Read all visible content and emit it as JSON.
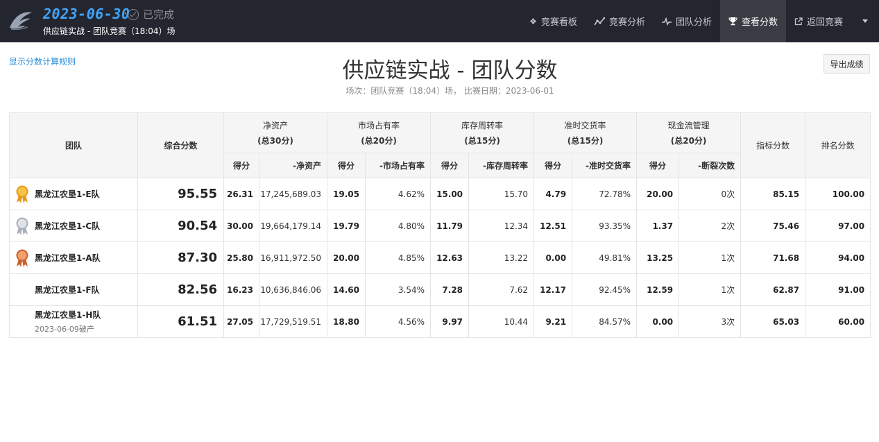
{
  "header": {
    "date": "2023-06-30",
    "status": "已完成",
    "subtitle": "供应链实战 - 团队竞赛（18:04）场"
  },
  "nav": [
    {
      "label": "竞赛看板",
      "icon": "dashboard-icon",
      "active": false
    },
    {
      "label": "竞赛分析",
      "icon": "line-chart-icon",
      "active": false
    },
    {
      "label": "团队分析",
      "icon": "pulse-icon",
      "active": false
    },
    {
      "label": "查看分数",
      "icon": "trophy-icon",
      "active": true
    },
    {
      "label": "返回竞赛",
      "icon": "external-link-icon",
      "active": false
    }
  ],
  "page": {
    "rule_link": "显示分数计算规则",
    "title": "供应链实战 - 团队分数",
    "subtitle": "场次：团队竞赛（18:04）场， 比赛日期：2023-06-01",
    "export_label": "导出成绩"
  },
  "table": {
    "col_team": "团队",
    "col_total": "综合分数",
    "groups": [
      {
        "name": "净资产",
        "weight": "(总30分)",
        "score_label": "得分",
        "value_label": "-净资产"
      },
      {
        "name": "市场占有率",
        "weight": "(总20分)",
        "score_label": "得分",
        "value_label": "-市场占有率"
      },
      {
        "name": "库存周转率",
        "weight": "(总15分)",
        "score_label": "得分",
        "value_label": "-库存周转率"
      },
      {
        "name": "准时交货率",
        "weight": "(总15分)",
        "score_label": "得分",
        "value_label": "-准时交货率"
      },
      {
        "name": "现金流管理",
        "weight": "(总20分)",
        "score_label": "得分",
        "value_label": "-断裂次数"
      }
    ],
    "col_index": "指标分数",
    "col_rank": "排名分数",
    "rows": [
      {
        "medal": "gold",
        "team": "黑龙江农垦1-E队",
        "note": "",
        "total": "95.55",
        "cells": [
          "26.31",
          "17,245,689.03",
          "19.05",
          "4.62%",
          "15.00",
          "15.70",
          "4.79",
          "72.78%",
          "20.00",
          "0次"
        ],
        "index_score": "85.15",
        "rank_score": "100.00"
      },
      {
        "medal": "silver",
        "team": "黑龙江农垦1-C队",
        "note": "",
        "total": "90.54",
        "cells": [
          "30.00",
          "19,664,179.14",
          "19.79",
          "4.80%",
          "11.79",
          "12.34",
          "12.51",
          "93.35%",
          "1.37",
          "2次"
        ],
        "index_score": "75.46",
        "rank_score": "97.00"
      },
      {
        "medal": "bronze",
        "team": "黑龙江农垦1-A队",
        "note": "",
        "total": "87.30",
        "cells": [
          "25.80",
          "16,911,972.50",
          "20.00",
          "4.85%",
          "12.63",
          "13.22",
          "0.00",
          "49.81%",
          "13.25",
          "1次"
        ],
        "index_score": "71.68",
        "rank_score": "94.00"
      },
      {
        "medal": "",
        "team": "黑龙江农垦1-F队",
        "note": "",
        "total": "82.56",
        "cells": [
          "16.23",
          "10,636,846.06",
          "14.60",
          "3.54%",
          "7.28",
          "7.62",
          "12.17",
          "92.45%",
          "12.59",
          "1次"
        ],
        "index_score": "62.87",
        "rank_score": "91.00"
      },
      {
        "medal": "",
        "team": "黑龙江农垦1-H队",
        "note": "2023-06-09破产",
        "total": "61.51",
        "cells": [
          "27.05",
          "17,729,519.51",
          "18.80",
          "4.56%",
          "9.97",
          "10.44",
          "9.21",
          "84.57%",
          "0.00",
          "3次"
        ],
        "index_score": "65.03",
        "rank_score": "60.00"
      }
    ]
  },
  "colors": {
    "topbar": "#24262f",
    "accent": "#3fa6ff",
    "link": "#2e8fd8",
    "gold": "#f2a21b",
    "silver": "#b8bec6",
    "bronze": "#d9743a"
  }
}
